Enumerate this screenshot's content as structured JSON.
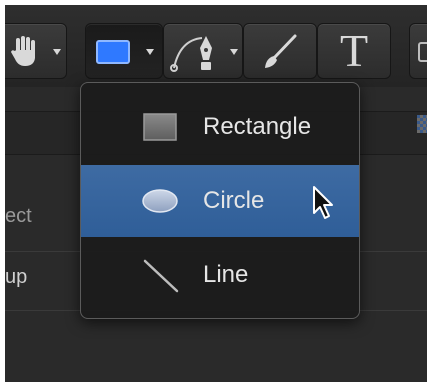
{
  "toolbar": {
    "tools": [
      {
        "icon": "hand-icon"
      },
      {
        "icon": "rectangle-shape-icon",
        "active": true
      },
      {
        "icon": "bezier-pen-icon"
      },
      {
        "icon": "paintbrush-icon"
      },
      {
        "icon": "text-tool-icon",
        "glyph": "T"
      }
    ]
  },
  "side_panel": {
    "labels": [
      "ect",
      "up"
    ]
  },
  "shape_menu": {
    "items": [
      {
        "label": "Rectangle",
        "icon": "rectangle-icon",
        "highlighted": false
      },
      {
        "label": "Circle",
        "icon": "circle-icon",
        "highlighted": true
      },
      {
        "label": "Line",
        "icon": "line-icon",
        "highlighted": false
      }
    ]
  },
  "colors": {
    "highlight": "#2f5e98",
    "shape_accent": "#2f79ff",
    "menu_background": "#1c1c1c"
  }
}
